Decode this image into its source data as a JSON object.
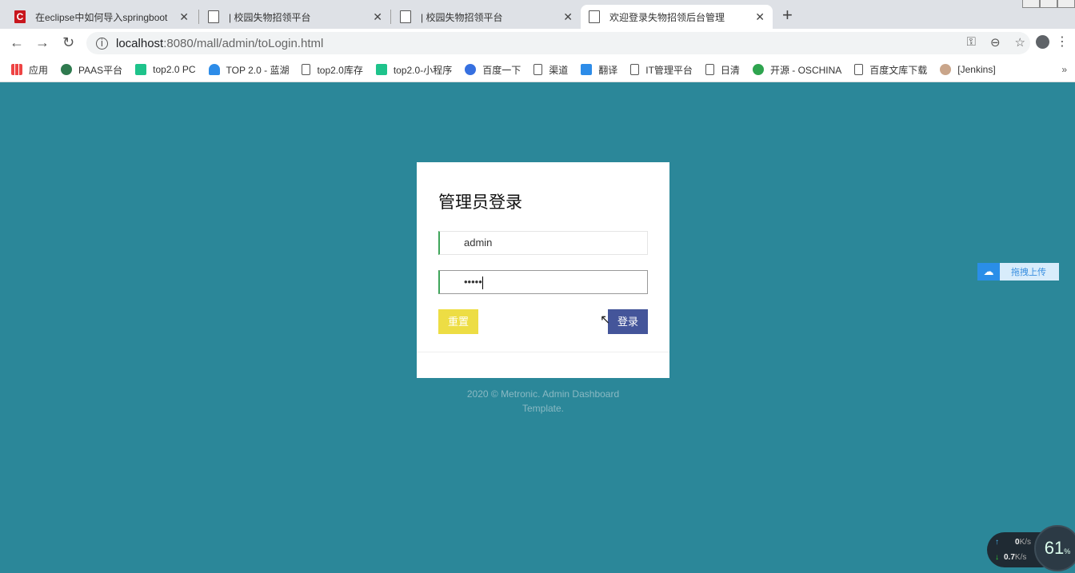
{
  "tabs": [
    {
      "title": "在eclipse中如何导入springboot",
      "icon": "csdn-icon"
    },
    {
      "title": "| 校园失物招领平台",
      "icon": "page-icon"
    },
    {
      "title": "| 校园失物招领平台",
      "icon": "page-icon"
    },
    {
      "title": "欢迎登录失物招领后台管理",
      "icon": "page-icon",
      "active": true
    }
  ],
  "url": {
    "host": "localhost",
    "path": ":8080/mall/admin/toLogin.html"
  },
  "bookmarks": [
    "应用",
    "PAAS平台",
    "top2.0 PC",
    "TOP 2.0 - 蓝湖",
    "top2.0库存",
    "top2.0-小程序",
    "百度一下",
    "渠道",
    "翻译",
    "IT管理平台",
    "日清",
    "开源 - OSCHINA",
    "百度文库下载",
    "[Jenkins]"
  ],
  "login": {
    "title": "管理员登录",
    "username": "admin",
    "password": "•••••",
    "reset_label": "重置",
    "login_label": "登录"
  },
  "footer": "2020 © Metronic. Admin Dashboard Template.",
  "upload_widget": "拖拽上传",
  "netmon": {
    "up": "0",
    "up_unit": "K/s",
    "down": "0.7",
    "down_unit": "K/s",
    "percent": "61",
    "pct_sign": "%"
  }
}
